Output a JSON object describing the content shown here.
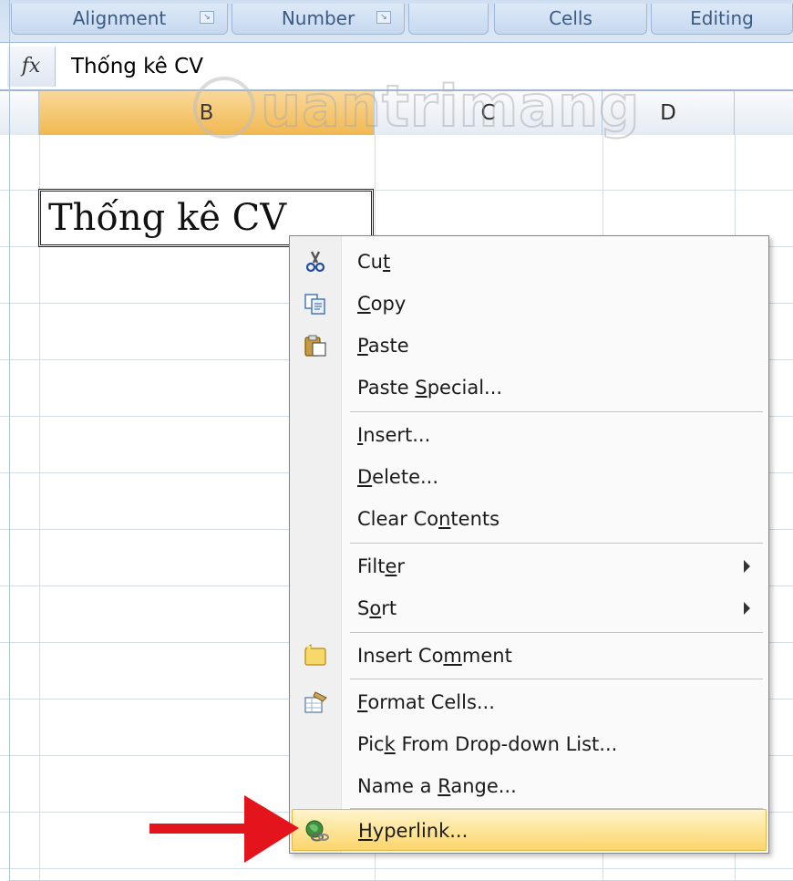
{
  "ribbon": {
    "groups": [
      {
        "label": "Alignment"
      },
      {
        "label": "Number"
      },
      {
        "label": ""
      },
      {
        "label": "Cells"
      },
      {
        "label": "Editing"
      }
    ]
  },
  "formula_bar": {
    "fx_label": "fx",
    "value": "Thống kê CV"
  },
  "columns": [
    {
      "label": ""
    },
    {
      "label": "B"
    },
    {
      "label": "C"
    },
    {
      "label": "D"
    },
    {
      "label": ""
    }
  ],
  "cell": {
    "ref": "B2",
    "value": "Thống kê CV"
  },
  "watermark": {
    "text": "uantrimang"
  },
  "context_menu": {
    "items": [
      {
        "label": "Cut",
        "icon": "scissors-icon"
      },
      {
        "label": "Copy",
        "icon": "copy-icon"
      },
      {
        "label": "Paste",
        "icon": "paste-icon"
      },
      {
        "label": "Paste Special..."
      },
      {
        "label": "Insert..."
      },
      {
        "label": "Delete..."
      },
      {
        "label": "Clear Contents"
      },
      {
        "label": "Filter",
        "submenu": true
      },
      {
        "label": "Sort",
        "submenu": true
      },
      {
        "label": "Insert Comment",
        "icon": "comment-icon"
      },
      {
        "label": "Format Cells...",
        "icon": "format-cells-icon"
      },
      {
        "label": "Pick From Drop-down List..."
      },
      {
        "label": "Name a Range..."
      },
      {
        "label": "Hyperlink...",
        "icon": "hyperlink-globe-icon",
        "highlighted": true
      }
    ]
  },
  "colors": {
    "selected_column": "#f2b850",
    "menu_highlight": "#fde59a",
    "annotation_arrow": "#e3141b"
  }
}
